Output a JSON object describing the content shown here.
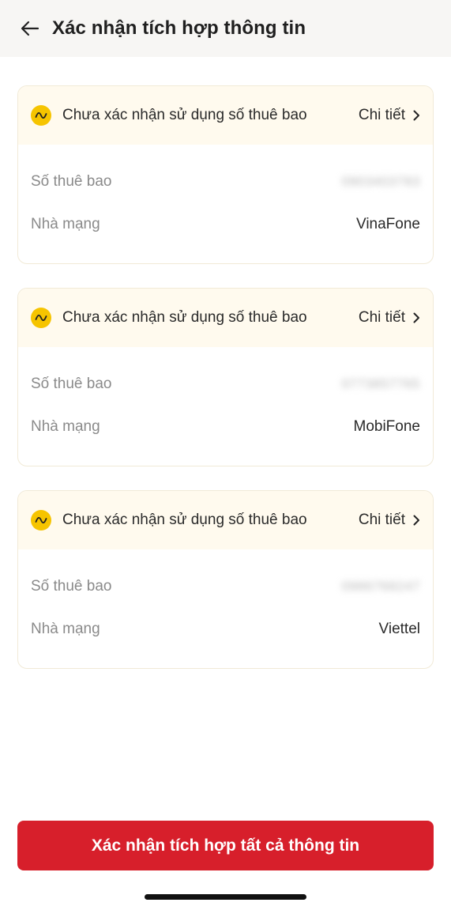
{
  "header": {
    "title": "Xác nhận tích hợp thông tin",
    "back_icon": "arrow-left-icon"
  },
  "cards": [
    {
      "status": "Chưa xác nhận sử dụng số thuê bao",
      "detail_label": "Chi tiết",
      "subscriber_label": "Số thuê bao",
      "subscriber_value": "0903403783",
      "carrier_label": "Nhà mạng",
      "carrier_value": "VinaFone"
    },
    {
      "status": "Chưa xác nhận sử dụng số thuê bao",
      "detail_label": "Chi tiết",
      "subscriber_label": "Số thuê bao",
      "subscriber_value": "0773857765",
      "carrier_label": "Nhà mạng",
      "carrier_value": "MobiFone"
    },
    {
      "status": "Chưa xác nhận sử dụng số thuê bao",
      "detail_label": "Chi tiết",
      "subscriber_label": "Số thuê bao",
      "subscriber_value": "0986768247",
      "carrier_label": "Nhà mạng",
      "carrier_value": "Viettel"
    }
  ],
  "confirm_button": {
    "label": "Xác nhận tích hợp tất cả thông tin"
  },
  "colors": {
    "accent": "#d71f2b",
    "warning": "#f6c400",
    "card_header_bg": "#fffaee"
  }
}
